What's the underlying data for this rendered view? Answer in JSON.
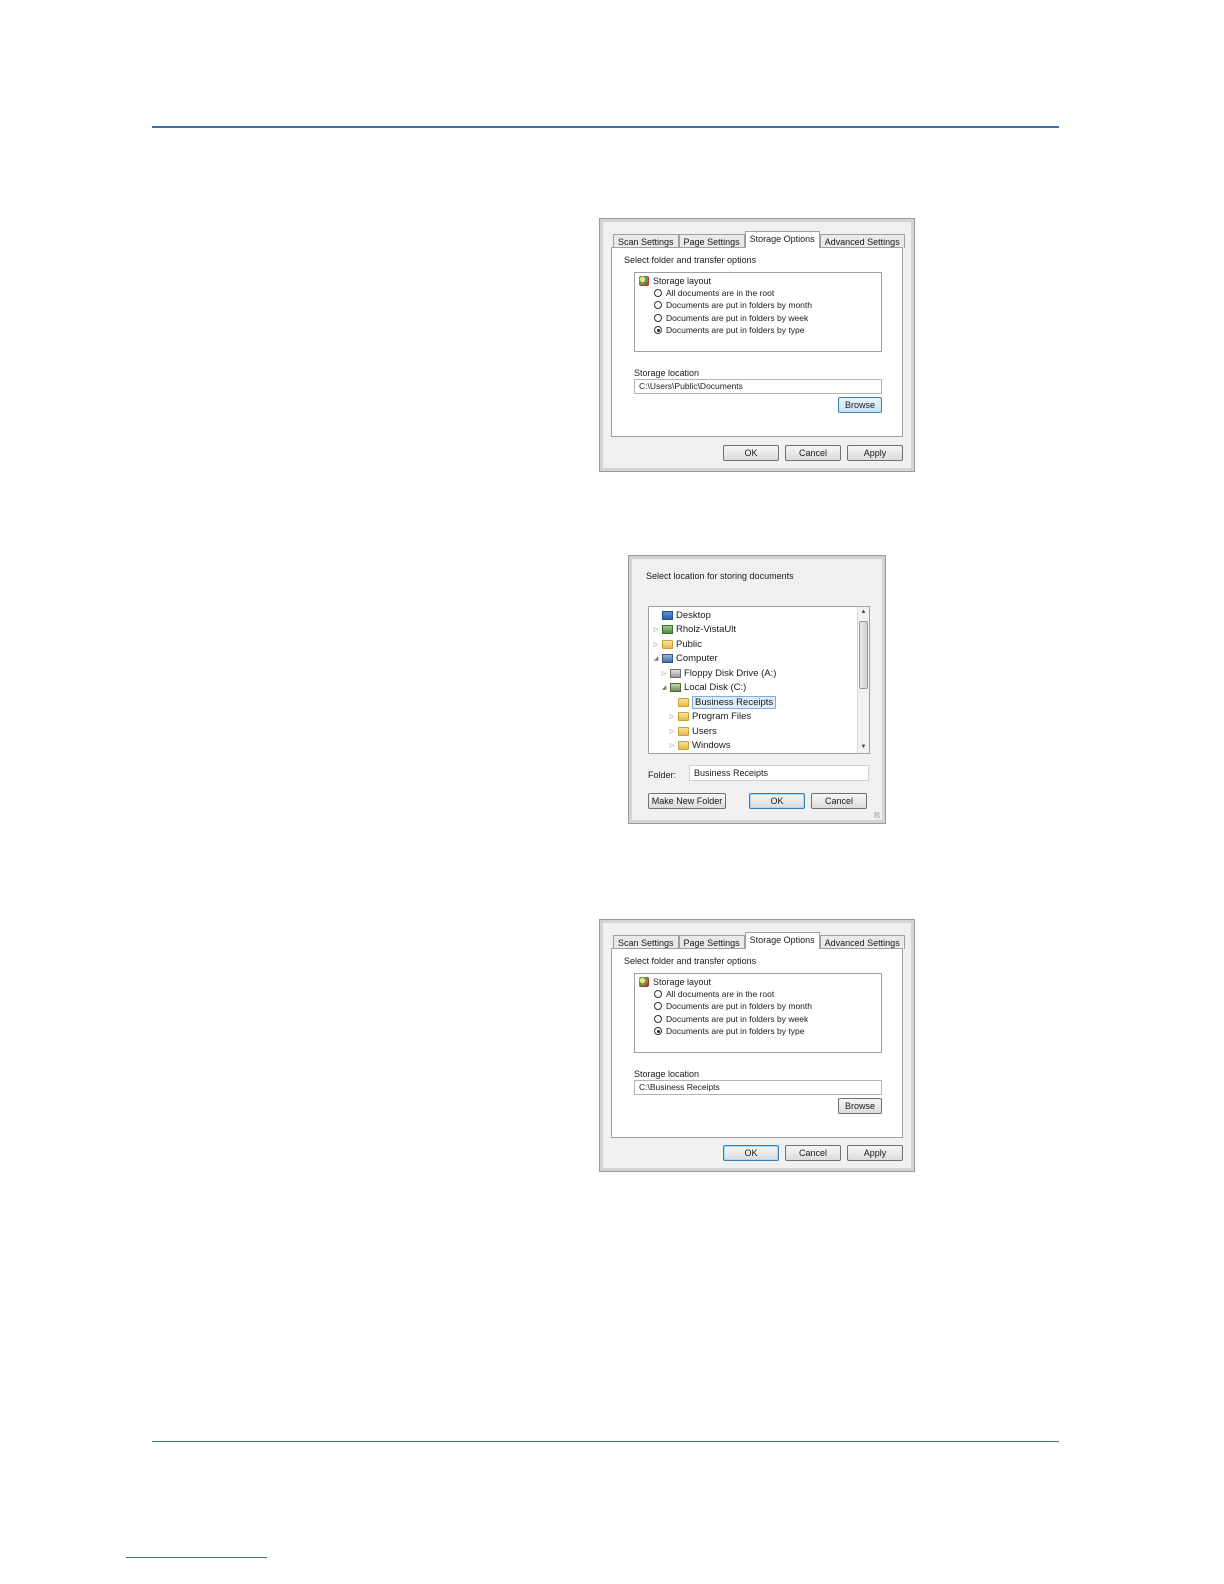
{
  "dialogs": {
    "props1": {
      "tabs": [
        "Scan Settings",
        "Page Settings",
        "Storage Options",
        "Advanced Settings"
      ],
      "section_title": "Select folder and transfer options",
      "layout_title": "Storage layout",
      "radios": [
        "All documents are in the root",
        "Documents are put in folders by month",
        "Documents are put in folders by week",
        "Documents are put in folders by type"
      ],
      "selected_radio": 3,
      "location_label": "Storage location",
      "location_value": "C:\\Users\\Public\\Documents",
      "browse": "Browse",
      "ok": "OK",
      "cancel": "Cancel",
      "apply": "Apply"
    },
    "browse": {
      "title": "Select location for storing documents",
      "tree": [
        {
          "label": "Desktop",
          "icon": "desktop-icon",
          "expander": ""
        },
        {
          "label": "Rholz-VistaUlt",
          "icon": "user-folder-icon",
          "expander": "▷"
        },
        {
          "label": "Public",
          "icon": "folder-icon",
          "expander": "▷"
        },
        {
          "label": "Computer",
          "icon": "computer-icon",
          "expander": "◢"
        },
        {
          "label": "Floppy Disk Drive (A:)",
          "icon": "floppy-drive-icon",
          "expander": "▷"
        },
        {
          "label": "Local Disk (C:)",
          "icon": "local-disk-icon",
          "expander": "◢"
        },
        {
          "label": "Business Receipts",
          "icon": "folder-icon",
          "expander": ""
        },
        {
          "label": "Program Files",
          "icon": "folder-icon",
          "expander": "▷"
        },
        {
          "label": "Users",
          "icon": "folder-icon",
          "expander": "▷"
        },
        {
          "label": "Windows",
          "icon": "folder-icon",
          "expander": "▷"
        }
      ],
      "selected_index": 6,
      "folder_label": "Folder:",
      "folder_value": "Business Receipts",
      "make_new_folder": "Make New Folder",
      "ok": "OK",
      "cancel": "Cancel"
    },
    "props2": {
      "tabs": [
        "Scan Settings",
        "Page Settings",
        "Storage Options",
        "Advanced Settings"
      ],
      "section_title": "Select folder and transfer options",
      "layout_title": "Storage layout",
      "radios": [
        "All documents are in the root",
        "Documents are put in folders by month",
        "Documents are put in folders by week",
        "Documents are put in folders by type"
      ],
      "selected_radio": 3,
      "location_label": "Storage location",
      "location_value": "C:\\Business Receipts",
      "browse": "Browse",
      "ok": "OK",
      "cancel": "Cancel",
      "apply": "Apply"
    }
  }
}
